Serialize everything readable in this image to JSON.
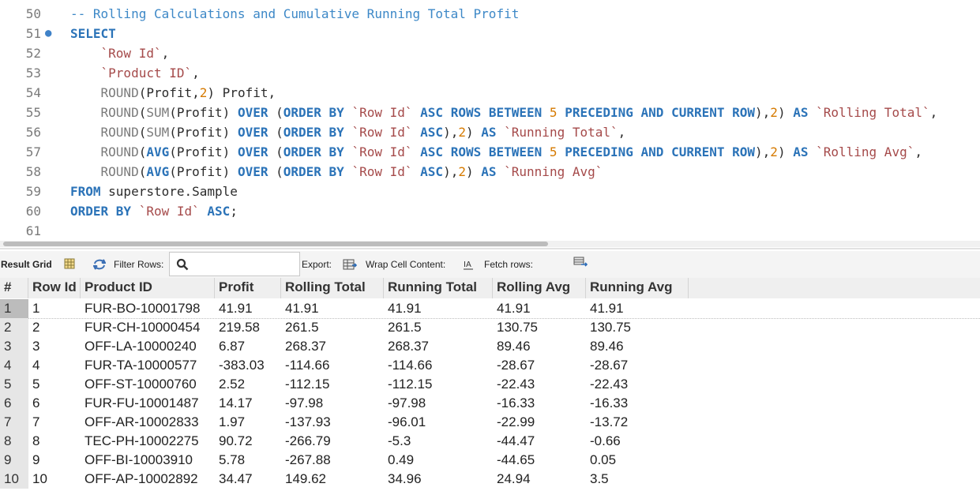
{
  "editor": {
    "lines": [
      {
        "num": "50",
        "marker": "",
        "tokens": [
          {
            "t": "cmt",
            "v": "-- Rolling Calculations and Cumulative Running Total Profit"
          }
        ]
      },
      {
        "num": "51",
        "marker": "●",
        "tokens": [
          {
            "t": "kw",
            "v": "SELECT"
          }
        ]
      },
      {
        "num": "52",
        "marker": "",
        "tokens": [
          {
            "t": "str",
            "v": "    `Row Id`"
          },
          {
            "t": "txt",
            "v": ","
          }
        ]
      },
      {
        "num": "53",
        "marker": "",
        "tokens": [
          {
            "t": "str",
            "v": "    `Product ID`"
          },
          {
            "t": "txt",
            "v": ","
          }
        ]
      },
      {
        "num": "54",
        "marker": "",
        "tokens": [
          {
            "t": "fn",
            "v": "    ROUND"
          },
          {
            "t": "txt",
            "v": "(Profit,"
          },
          {
            "t": "num",
            "v": "2"
          },
          {
            "t": "txt",
            "v": ") Profit,"
          }
        ]
      },
      {
        "num": "55",
        "marker": "",
        "tokens": [
          {
            "t": "fn",
            "v": "    ROUND"
          },
          {
            "t": "txt",
            "v": "("
          },
          {
            "t": "fn",
            "v": "SUM"
          },
          {
            "t": "txt",
            "v": "(Profit) "
          },
          {
            "t": "kw",
            "v": "OVER"
          },
          {
            "t": "txt",
            "v": " ("
          },
          {
            "t": "kw",
            "v": "ORDER BY"
          },
          {
            "t": "txt",
            "v": " "
          },
          {
            "t": "str",
            "v": "`Row Id`"
          },
          {
            "t": "txt",
            "v": " "
          },
          {
            "t": "kw",
            "v": "ASC ROWS BETWEEN"
          },
          {
            "t": "txt",
            "v": " "
          },
          {
            "t": "num",
            "v": "5"
          },
          {
            "t": "txt",
            "v": " "
          },
          {
            "t": "kw",
            "v": "PRECEDING AND CURRENT ROW"
          },
          {
            "t": "txt",
            "v": "),"
          },
          {
            "t": "num",
            "v": "2"
          },
          {
            "t": "txt",
            "v": ") "
          },
          {
            "t": "kw",
            "v": "AS"
          },
          {
            "t": "txt",
            "v": " "
          },
          {
            "t": "str",
            "v": "`Rolling Total`"
          },
          {
            "t": "txt",
            "v": ","
          }
        ]
      },
      {
        "num": "56",
        "marker": "",
        "tokens": [
          {
            "t": "fn",
            "v": "    ROUND"
          },
          {
            "t": "txt",
            "v": "("
          },
          {
            "t": "fn",
            "v": "SUM"
          },
          {
            "t": "txt",
            "v": "(Profit) "
          },
          {
            "t": "kw",
            "v": "OVER"
          },
          {
            "t": "txt",
            "v": " ("
          },
          {
            "t": "kw",
            "v": "ORDER BY"
          },
          {
            "t": "txt",
            "v": " "
          },
          {
            "t": "str",
            "v": "`Row Id`"
          },
          {
            "t": "txt",
            "v": " "
          },
          {
            "t": "kw",
            "v": "ASC"
          },
          {
            "t": "txt",
            "v": "),"
          },
          {
            "t": "num",
            "v": "2"
          },
          {
            "t": "txt",
            "v": ") "
          },
          {
            "t": "kw",
            "v": "AS"
          },
          {
            "t": "txt",
            "v": " "
          },
          {
            "t": "str",
            "v": "`Running Total`"
          },
          {
            "t": "txt",
            "v": ","
          }
        ]
      },
      {
        "num": "57",
        "marker": "",
        "tokens": [
          {
            "t": "fn",
            "v": "    ROUND"
          },
          {
            "t": "txt",
            "v": "("
          },
          {
            "t": "kw",
            "v": "AVG"
          },
          {
            "t": "txt",
            "v": "(Profit) "
          },
          {
            "t": "kw",
            "v": "OVER"
          },
          {
            "t": "txt",
            "v": " ("
          },
          {
            "t": "kw",
            "v": "ORDER BY"
          },
          {
            "t": "txt",
            "v": " "
          },
          {
            "t": "str",
            "v": "`Row Id`"
          },
          {
            "t": "txt",
            "v": " "
          },
          {
            "t": "kw",
            "v": "ASC ROWS BETWEEN"
          },
          {
            "t": "txt",
            "v": " "
          },
          {
            "t": "num",
            "v": "5"
          },
          {
            "t": "txt",
            "v": " "
          },
          {
            "t": "kw",
            "v": "PRECEDING AND CURRENT ROW"
          },
          {
            "t": "txt",
            "v": "),"
          },
          {
            "t": "num",
            "v": "2"
          },
          {
            "t": "txt",
            "v": ") "
          },
          {
            "t": "kw",
            "v": "AS"
          },
          {
            "t": "txt",
            "v": " "
          },
          {
            "t": "str",
            "v": "`Rolling Avg`"
          },
          {
            "t": "txt",
            "v": ","
          }
        ]
      },
      {
        "num": "58",
        "marker": "",
        "tokens": [
          {
            "t": "fn",
            "v": "    ROUND"
          },
          {
            "t": "txt",
            "v": "("
          },
          {
            "t": "kw",
            "v": "AVG"
          },
          {
            "t": "txt",
            "v": "(Profit) "
          },
          {
            "t": "kw",
            "v": "OVER"
          },
          {
            "t": "txt",
            "v": " ("
          },
          {
            "t": "kw",
            "v": "ORDER BY"
          },
          {
            "t": "txt",
            "v": " "
          },
          {
            "t": "str",
            "v": "`Row Id`"
          },
          {
            "t": "txt",
            "v": " "
          },
          {
            "t": "kw",
            "v": "ASC"
          },
          {
            "t": "txt",
            "v": "),"
          },
          {
            "t": "num",
            "v": "2"
          },
          {
            "t": "txt",
            "v": ") "
          },
          {
            "t": "kw",
            "v": "AS"
          },
          {
            "t": "txt",
            "v": " "
          },
          {
            "t": "str",
            "v": "`Running Avg`"
          }
        ]
      },
      {
        "num": "59",
        "marker": "",
        "tokens": [
          {
            "t": "kw",
            "v": "FROM"
          },
          {
            "t": "txt",
            "v": " superstore.Sample"
          }
        ]
      },
      {
        "num": "60",
        "marker": "",
        "tokens": [
          {
            "t": "kw",
            "v": "ORDER BY"
          },
          {
            "t": "txt",
            "v": " "
          },
          {
            "t": "str",
            "v": "`Row Id`"
          },
          {
            "t": "txt",
            "v": " "
          },
          {
            "t": "kw",
            "v": "ASC"
          },
          {
            "t": "txt",
            "v": ";"
          }
        ]
      },
      {
        "num": "61",
        "marker": "",
        "tokens": []
      }
    ]
  },
  "toolbar": {
    "result_grid_label": "Result Grid",
    "filter_rows_label": "Filter Rows:",
    "filter_value": "",
    "export_label": "Export:",
    "wrap_label": "Wrap Cell Content:",
    "fetch_label": "Fetch rows:"
  },
  "grid": {
    "columns": [
      "#",
      "Row Id",
      "Product ID",
      "Profit",
      "Rolling Total",
      "Running Total",
      "Rolling Avg",
      "Running Avg"
    ],
    "rows": [
      [
        "1",
        "1",
        "FUR-BO-10001798",
        "41.91",
        "41.91",
        "41.91",
        "41.91",
        "41.91"
      ],
      [
        "2",
        "2",
        "FUR-CH-10000454",
        "219.58",
        "261.5",
        "261.5",
        "130.75",
        "130.75"
      ],
      [
        "3",
        "3",
        "OFF-LA-10000240",
        "6.87",
        "268.37",
        "268.37",
        "89.46",
        "89.46"
      ],
      [
        "4",
        "4",
        "FUR-TA-10000577",
        "-383.03",
        "-114.66",
        "-114.66",
        "-28.67",
        "-28.67"
      ],
      [
        "5",
        "5",
        "OFF-ST-10000760",
        "2.52",
        "-112.15",
        "-112.15",
        "-22.43",
        "-22.43"
      ],
      [
        "6",
        "6",
        "FUR-FU-10001487",
        "14.17",
        "-97.98",
        "-97.98",
        "-16.33",
        "-16.33"
      ],
      [
        "7",
        "7",
        "OFF-AR-10002833",
        "1.97",
        "-137.93",
        "-96.01",
        "-22.99",
        "-13.72"
      ],
      [
        "8",
        "8",
        "TEC-PH-10002275",
        "90.72",
        "-266.79",
        "-5.3",
        "-44.47",
        "-0.66"
      ],
      [
        "9",
        "9",
        "OFF-BI-10003910",
        "5.78",
        "-267.88",
        "0.49",
        "-44.65",
        "0.05"
      ],
      [
        "10",
        "10",
        "OFF-AP-10002892",
        "34.47",
        "149.62",
        "34.96",
        "24.94",
        "3.5"
      ]
    ]
  }
}
